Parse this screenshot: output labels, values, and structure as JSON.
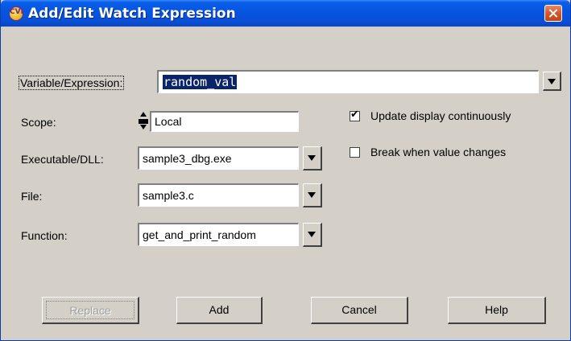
{
  "window": {
    "title": "Add/Edit Watch Expression",
    "app_icon": "cvi-app-icon"
  },
  "fields": {
    "variable_label": "Variable/Expression:",
    "variable_value": "random_val",
    "scope_label": "Scope:",
    "scope_value": "Local",
    "executable_label": "Executable/DLL:",
    "executable_value": "sample3_dbg.exe",
    "file_label": "File:",
    "file_value": "sample3.c",
    "function_label": "Function:",
    "function_value": "get_and_print_random"
  },
  "options": {
    "update_label": "Update display continuously",
    "update_checked": true,
    "break_label": "Break when value changes",
    "break_checked": false
  },
  "buttons": {
    "replace": "Replace",
    "add": "Add",
    "cancel": "Cancel",
    "help": "Help"
  }
}
